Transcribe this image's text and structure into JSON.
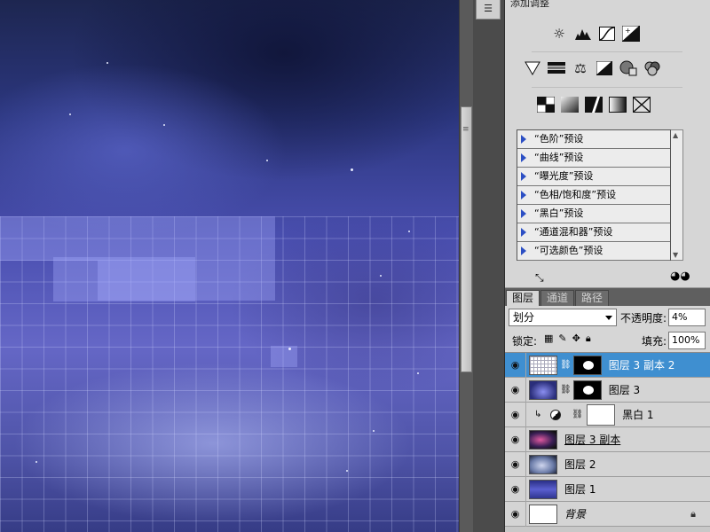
{
  "adjustments_panel": {
    "title": "添加调整",
    "row1_icons": [
      "brightness-contrast-icon",
      "levels-icon",
      "curves-icon",
      "exposure-icon"
    ],
    "row2_icons": [
      "vibrance-icon",
      "hue-saturation-icon",
      "color-balance-icon",
      "black-white-icon",
      "photo-filter-icon",
      "channel-mixer-icon"
    ],
    "row3_icons": [
      "invert-icon",
      "posterize-icon",
      "threshold-icon",
      "gradient-map-icon",
      "selective-color-icon"
    ],
    "presets": [
      {
        "label": "“色阶”预设"
      },
      {
        "label": "“曲线”预设"
      },
      {
        "label": "“曝光度”预设"
      },
      {
        "label": "“色相/饱和度”预设"
      },
      {
        "label": "“黑白”预设"
      },
      {
        "label": "“通道混和器”预设"
      },
      {
        "label": "“可选颜色”预设"
      }
    ]
  },
  "layers_panel": {
    "tabs": [
      {
        "label": "图层",
        "active": true
      },
      {
        "label": "通道",
        "active": false
      },
      {
        "label": "路径",
        "active": false
      }
    ],
    "blend_mode": "划分",
    "opacity_label": "不透明度:",
    "opacity_value": "4%",
    "lock_label": "锁定:",
    "fill_label": "填充:",
    "fill_value": "100%",
    "layers": [
      {
        "name": "图层 3 副本 2",
        "selected": true
      },
      {
        "name": "图层 3",
        "selected": false
      },
      {
        "name": "黑白 1",
        "selected": false
      },
      {
        "name": "图层 3 副本",
        "selected": false
      },
      {
        "name": "图层 2",
        "selected": false
      },
      {
        "name": "图层 1",
        "selected": false
      },
      {
        "name": "背景",
        "selected": false
      }
    ]
  }
}
